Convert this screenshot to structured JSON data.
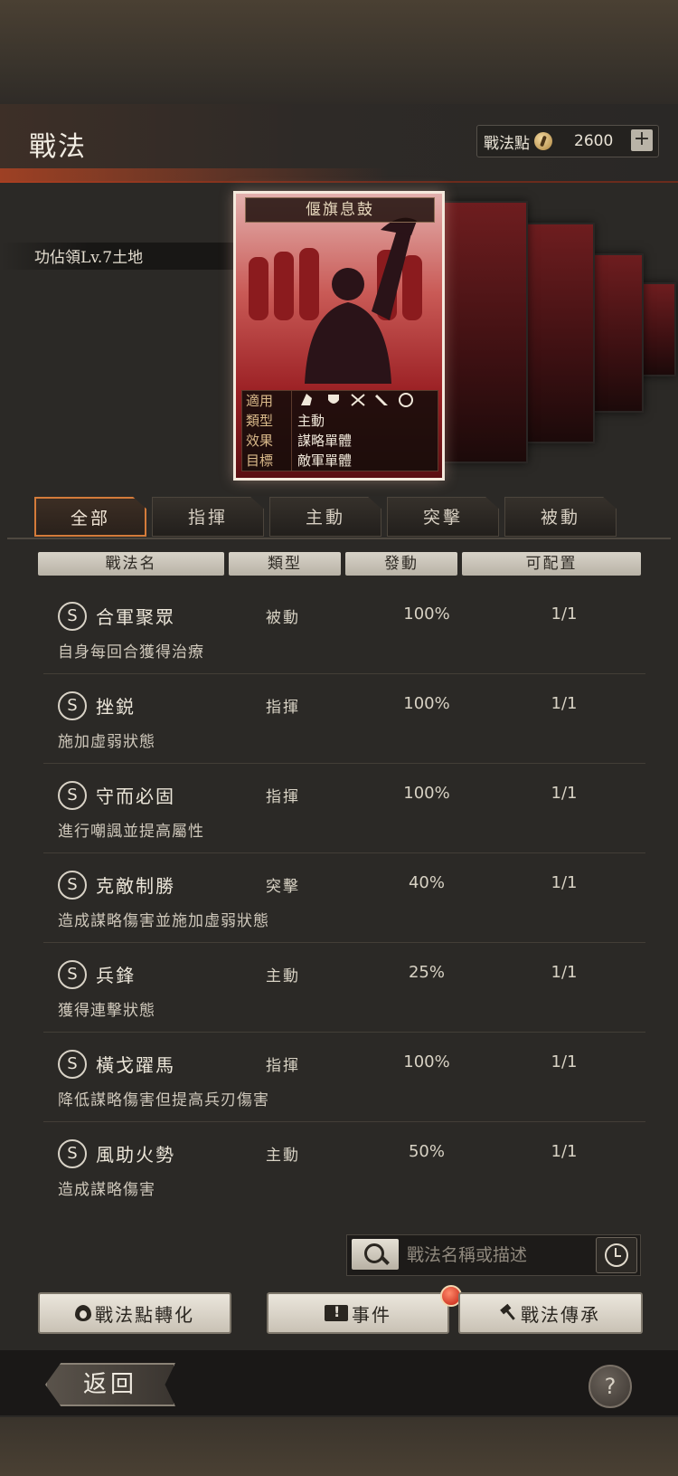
{
  "header": {
    "title": "戰法",
    "points_label": "戰法點",
    "points_value": "2600"
  },
  "banner": {
    "text": "功佔領Lv.7土地"
  },
  "card": {
    "title": "偃旗息鼓",
    "rows": [
      {
        "key": "適用",
        "value": ""
      },
      {
        "key": "類型",
        "value": "主動"
      },
      {
        "key": "效果",
        "value": "謀略單體"
      },
      {
        "key": "目標",
        "value": "敵軍單體"
      }
    ]
  },
  "tabs": [
    "全部",
    "指揮",
    "主動",
    "突擊",
    "被動"
  ],
  "columns": [
    "戰法名",
    "類型",
    "發動",
    "可配置"
  ],
  "tactics": [
    {
      "grade": "S",
      "name": "合軍聚眾",
      "type": "被動",
      "rate": "100%",
      "slots": "1/1",
      "desc": "自身每回合獲得治療"
    },
    {
      "grade": "S",
      "name": "挫鋭",
      "type": "指揮",
      "rate": "100%",
      "slots": "1/1",
      "desc": "施加虛弱狀態"
    },
    {
      "grade": "S",
      "name": "守而必固",
      "type": "指揮",
      "rate": "100%",
      "slots": "1/1",
      "desc": "進行嘲諷並提高屬性"
    },
    {
      "grade": "S",
      "name": "克敵制勝",
      "type": "突擊",
      "rate": "40%",
      "slots": "1/1",
      "desc": "造成謀略傷害並施加虛弱狀態"
    },
    {
      "grade": "S",
      "name": "兵鋒",
      "type": "主動",
      "rate": "25%",
      "slots": "1/1",
      "desc": "獲得連擊狀態"
    },
    {
      "grade": "S",
      "name": "橫戈躍馬",
      "type": "指揮",
      "rate": "100%",
      "slots": "1/1",
      "desc": "降低謀略傷害但提高兵刃傷害"
    },
    {
      "grade": "S",
      "name": "風助火勢",
      "type": "主動",
      "rate": "50%",
      "slots": "1/1",
      "desc": "造成謀略傷害"
    }
  ],
  "search": {
    "placeholder": "戰法名稱或描述"
  },
  "actions": {
    "convert": "戰法點轉化",
    "events": "事件",
    "inherit": "戰法傳承"
  },
  "footer": {
    "back": "返回",
    "help": "?"
  }
}
